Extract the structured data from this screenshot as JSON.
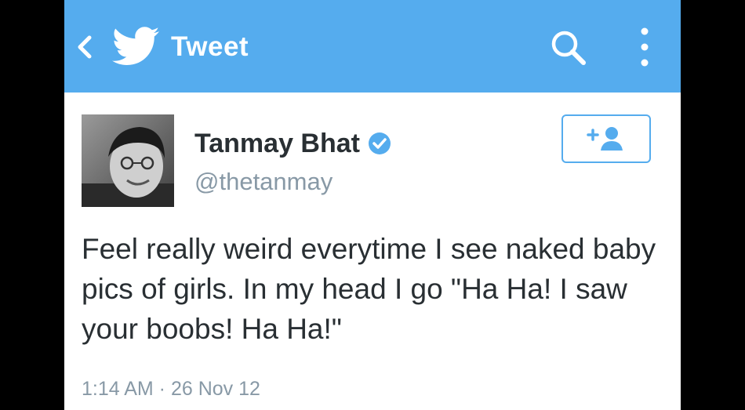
{
  "header": {
    "title": "Tweet",
    "back_icon": "chevron-left-icon",
    "logo_icon": "twitter-bird-icon",
    "search_icon": "search-icon",
    "more_icon": "more-vertical-icon",
    "bar_color": "#55acee"
  },
  "tweet": {
    "author_name": "Tanmay Bhat",
    "verified": true,
    "handle": "@thetanmay",
    "text": "Feel really weird everytime I see naked baby pics of girls. In my head I go \"Ha Ha! I saw your boobs! Ha Ha!\"",
    "timestamp": "1:14 AM · 26 Nov 12",
    "follow_icon": "follow-user-icon",
    "accent_color": "#55acee"
  }
}
